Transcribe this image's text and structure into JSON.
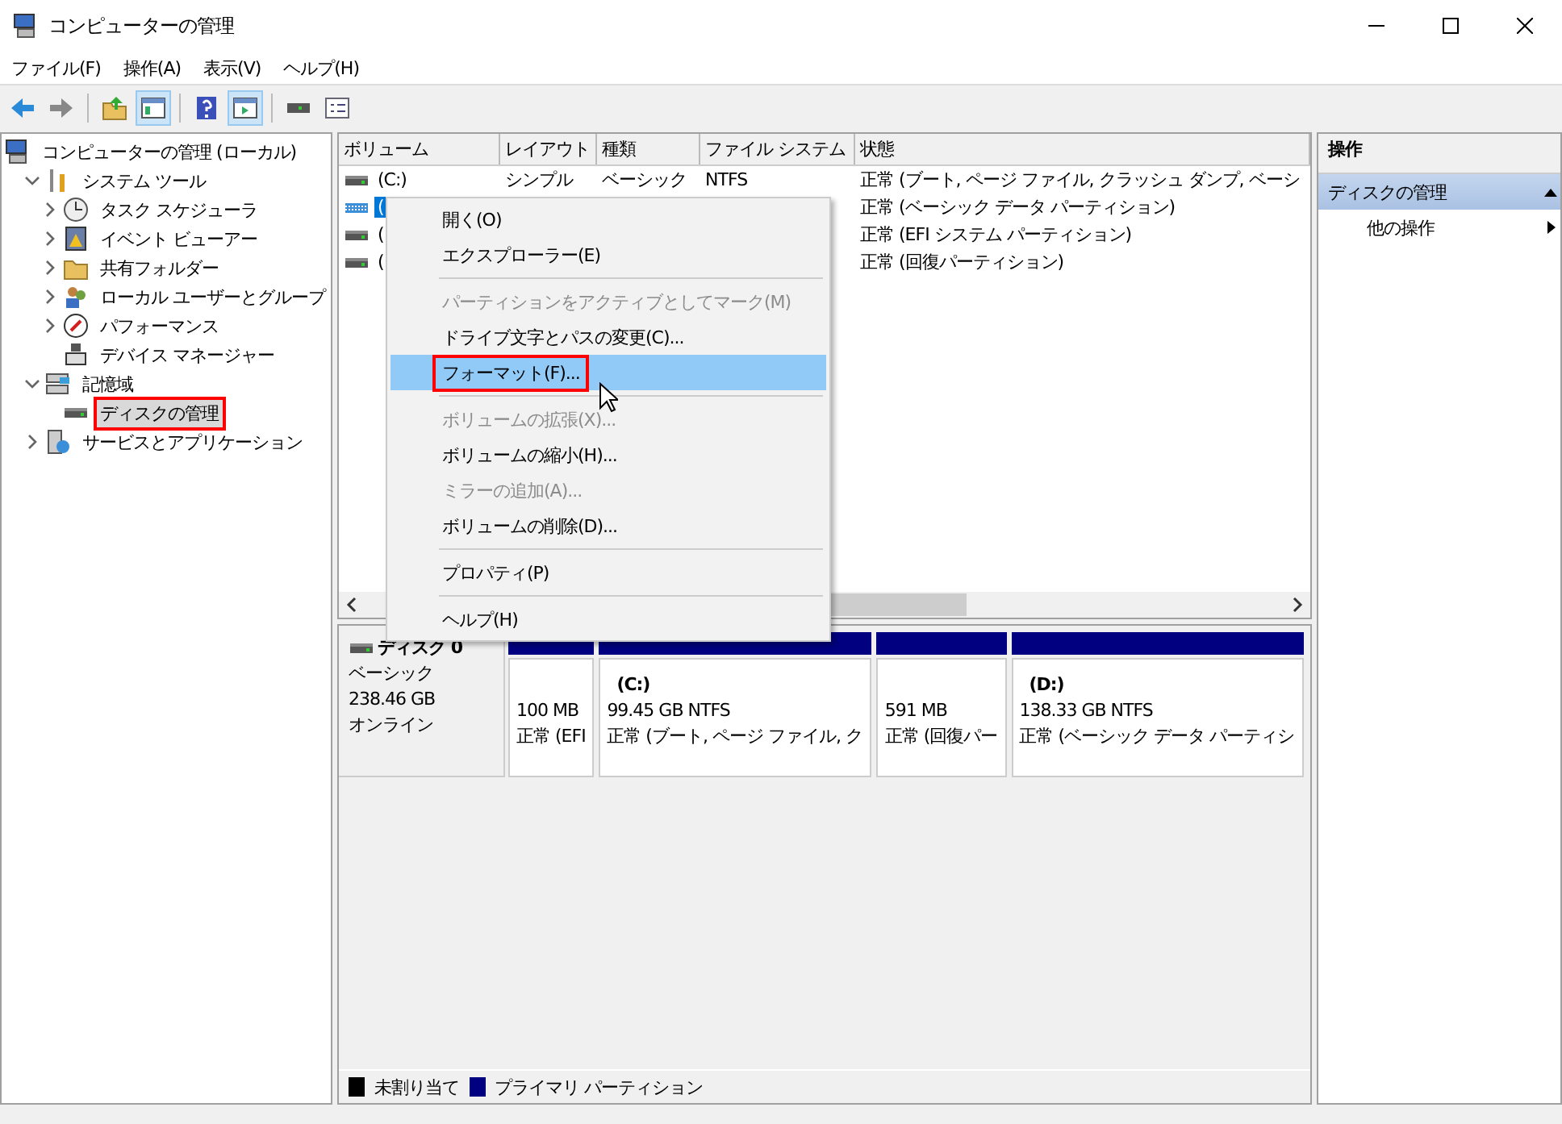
{
  "window": {
    "title": "コンピューターの管理"
  },
  "menu": [
    "ファイル(F)",
    "操作(A)",
    "表示(V)",
    "ヘルプ(H)"
  ],
  "toolbar": [
    {
      "kind": "back",
      "pressed": false
    },
    {
      "kind": "forward",
      "pressed": false
    },
    {
      "kind": "separator"
    },
    {
      "kind": "up",
      "pressed": false
    },
    {
      "kind": "tree",
      "pressed": true
    },
    {
      "kind": "separator"
    },
    {
      "kind": "help",
      "pressed": false
    },
    {
      "kind": "pane",
      "pressed": true
    },
    {
      "kind": "separator"
    },
    {
      "kind": "connect",
      "pressed": false
    },
    {
      "kind": "list",
      "pressed": false
    }
  ],
  "tree": [
    {
      "label": "コンピューターの管理 (ローカル)",
      "selected": false,
      "annotated": false,
      "children": [
        {
          "label": "システム ツール",
          "expanded": true,
          "selected": false,
          "annotated": false,
          "children": [
            {
              "label": "タスク スケジューラ",
              "expanded": false,
              "selected": false,
              "annotated": false
            },
            {
              "label": "イベント ビューアー",
              "expanded": false,
              "selected": false,
              "annotated": false
            },
            {
              "label": "共有フォルダー",
              "expanded": false,
              "selected": false,
              "annotated": false
            },
            {
              "label": "ローカル ユーザーとグループ",
              "expanded": false,
              "selected": false,
              "annotated": false
            },
            {
              "label": "パフォーマンス",
              "expanded": false,
              "selected": false,
              "annotated": false
            },
            {
              "label": "デバイス マネージャー",
              "selected": false,
              "annotated": false
            }
          ]
        },
        {
          "label": "記憶域",
          "expanded": true,
          "selected": false,
          "annotated": false,
          "children": [
            {
              "label": "ディスクの管理",
              "selected": true,
              "annotated": true
            }
          ]
        },
        {
          "label": "サービスとアプリケーション",
          "expanded": false,
          "selected": false,
          "annotated": false
        }
      ]
    }
  ],
  "volume_table": {
    "columns": [
      "ボリューム",
      "レイアウト",
      "種類",
      "ファイル システム",
      "状態"
    ],
    "rows": [
      {
        "cells": [
          "(C:)",
          "シンプル",
          "ベーシック",
          "NTFS",
          "正常 (ブート, ページ ファイル, クラッシュ ダンプ, ベーシ"
        ],
        "selected": false
      },
      {
        "cells": [
          "(",
          "",
          "",
          "",
          "正常 (ベーシック データ パーティション)"
        ],
        "selected": true
      },
      {
        "cells": [
          "(",
          "",
          "",
          "",
          "正常 (EFI システム パーティション)"
        ],
        "selected": false
      },
      {
        "cells": [
          "(",
          "",
          "",
          "",
          "正常 (回復パーティション)"
        ],
        "selected": false
      }
    ]
  },
  "context_menu": [
    {
      "kind": "item",
      "label": "開く(O)",
      "disabled": false,
      "selected": false,
      "annotated": false
    },
    {
      "kind": "item",
      "label": "エクスプローラー(E)",
      "disabled": false,
      "selected": false,
      "annotated": false
    },
    {
      "kind": "separator"
    },
    {
      "kind": "item",
      "label": "パーティションをアクティブとしてマーク(M)",
      "disabled": true,
      "selected": false,
      "annotated": false
    },
    {
      "kind": "item",
      "label": "ドライブ文字とパスの変更(C)...",
      "disabled": false,
      "selected": false,
      "annotated": false
    },
    {
      "kind": "item",
      "label": "フォーマット(F)...",
      "disabled": false,
      "selected": true,
      "annotated": true
    },
    {
      "kind": "separator"
    },
    {
      "kind": "item",
      "label": "ボリュームの拡張(X)...",
      "disabled": true,
      "selected": false,
      "annotated": false
    },
    {
      "kind": "item",
      "label": "ボリュームの縮小(H)...",
      "disabled": false,
      "selected": false,
      "annotated": false
    },
    {
      "kind": "item",
      "label": "ミラーの追加(A)...",
      "disabled": true,
      "selected": false,
      "annotated": false
    },
    {
      "kind": "item",
      "label": "ボリュームの削除(D)...",
      "disabled": false,
      "selected": false,
      "annotated": false
    },
    {
      "kind": "separator"
    },
    {
      "kind": "item",
      "label": "プロパティ(P)",
      "disabled": false,
      "selected": false,
      "annotated": false
    },
    {
      "kind": "separator"
    },
    {
      "kind": "item",
      "label": "ヘルプ(H)",
      "disabled": false,
      "selected": false,
      "annotated": false
    }
  ],
  "disk_map": {
    "disk": {
      "name": "ディスク 0",
      "type": "ベーシック",
      "size": "238.46 GB",
      "status": "オンライン"
    },
    "partitions": [
      {
        "size": "100 MB",
        "status": "正常 (EFI",
        "color": "#000080"
      },
      {
        "name": "(C:)",
        "size": "99.45 GB NTFS",
        "status": "正常 (ブート, ページ ファイル, ク",
        "color": "#000080"
      },
      {
        "size": "591 MB",
        "status": "正常 (回復パー",
        "color": "#000080"
      },
      {
        "name": "(D:)",
        "size": "138.33 GB NTFS",
        "status": "正常 (ベーシック データ パーティシ",
        "color": "#000080"
      }
    ]
  },
  "legend": [
    {
      "label": "未割り当て",
      "color": "#000000"
    },
    {
      "label": "プライマリ パーティション",
      "color": "#000080"
    }
  ],
  "actions": {
    "title": "操作",
    "section": "ディスクの管理",
    "items": [
      "他の操作"
    ]
  }
}
